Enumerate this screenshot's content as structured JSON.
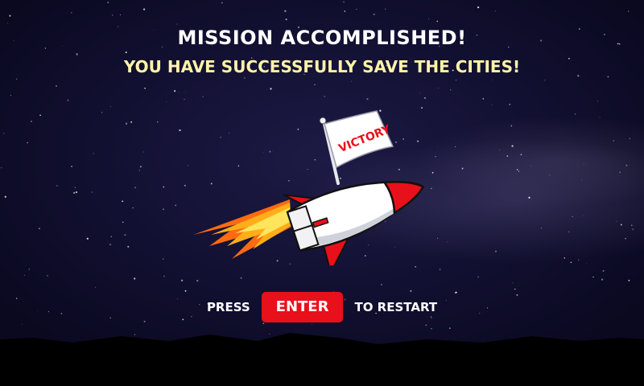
{
  "screen": {
    "title": "MISSION ACCOMPLISHED!",
    "subtitle": "YOU HAVE SUCCESSFULLY SAVE THE CITIES!"
  },
  "flag": {
    "text": "VICTORY"
  },
  "prompt": {
    "before": "PRESS",
    "key": "ENTER",
    "after": "TO RESTART"
  },
  "colors": {
    "accent": "#e8101a",
    "subtitle": "#fff4a8",
    "title": "#ffffff"
  }
}
